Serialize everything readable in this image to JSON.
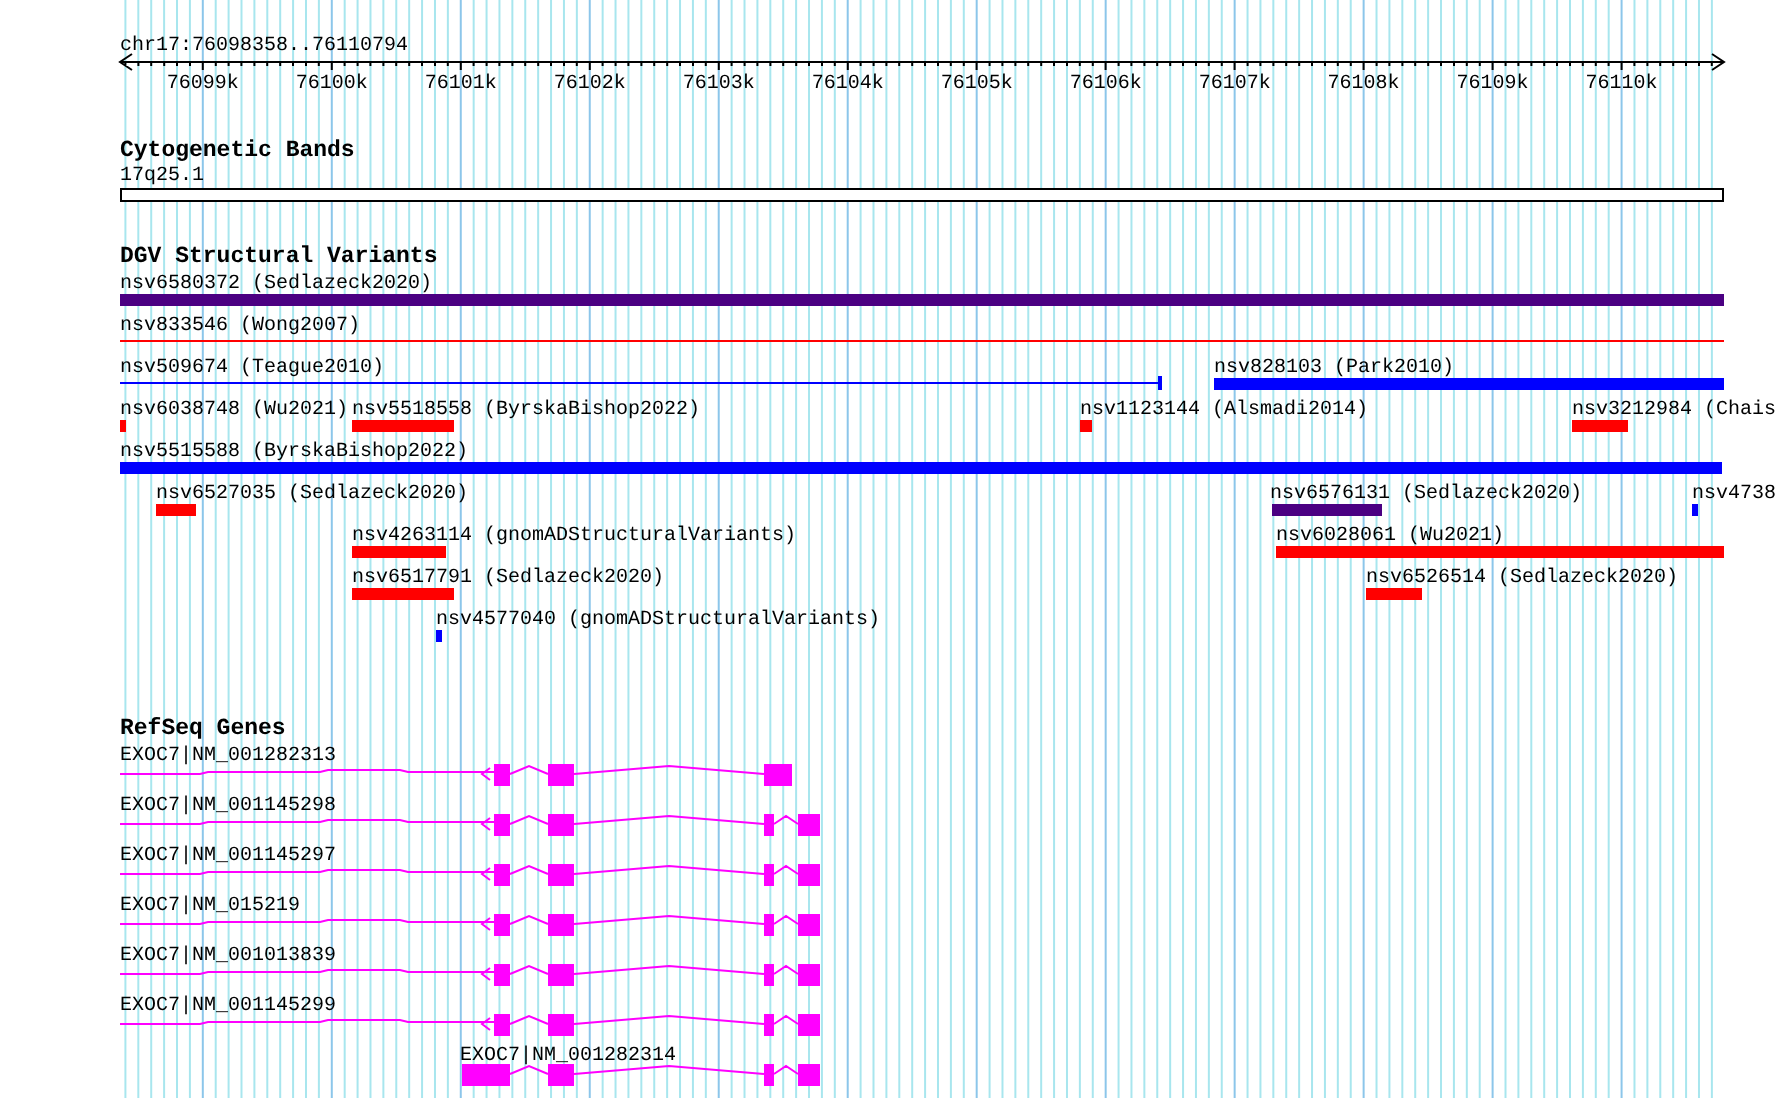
{
  "ruler": {
    "location": "chr17:76098358..76110794",
    "ticks": [
      "76099k",
      "76100k",
      "76101k",
      "76102k",
      "76103k",
      "76104k",
      "76105k",
      "76106k",
      "76107k",
      "76108k",
      "76109k",
      "76110k"
    ]
  },
  "tracks": [
    {
      "title": "Cytogenetic Bands",
      "kind": "bands",
      "features": [
        {
          "label": "17q25.1"
        }
      ]
    },
    {
      "title": "DGV Structural Variants",
      "kind": "variants",
      "features": [
        {
          "label": "nsv6580372 (Sedlazeck2020)",
          "kind": "bar",
          "color": "#4b0082"
        },
        {
          "label": "nsv833546 (Wong2007)",
          "kind": "line",
          "color": "#ff0000"
        },
        {
          "label": "nsv509674 (Teague2010)",
          "kind": "line",
          "color": "#0000ff"
        },
        {
          "label": "nsv828103 (Park2010)",
          "kind": "bar",
          "color": "#0000ff"
        },
        {
          "label": "nsv6038748 (Wu2021)",
          "kind": "bar",
          "color": "#ff0000"
        },
        {
          "label": "nsv5518558 (ByrskaBishop2022)",
          "kind": "bar",
          "color": "#ff0000"
        },
        {
          "label": "nsv1123144 (Alsmadi2014)",
          "kind": "bar",
          "color": "#ff0000"
        },
        {
          "label": "nsv3212984 (Chais",
          "kind": "bar",
          "color": "#ff0000"
        },
        {
          "label": "nsv5515588 (ByrskaBishop2022)",
          "kind": "bar",
          "color": "#0000ff"
        },
        {
          "label": "nsv6527035 (Sedlazeck2020)",
          "kind": "bar",
          "color": "#ff0000"
        },
        {
          "label": "nsv6576131 (Sedlazeck2020)",
          "kind": "bar",
          "color": "#4b0082"
        },
        {
          "label": "nsv4738",
          "kind": "bar",
          "color": "#0000ff"
        },
        {
          "label": "nsv4263114 (gnomADStructuralVariants)",
          "kind": "bar",
          "color": "#ff0000"
        },
        {
          "label": "nsv6028061 (Wu2021)",
          "kind": "bar",
          "color": "#ff0000"
        },
        {
          "label": "nsv6517791 (Sedlazeck2020)",
          "kind": "bar",
          "color": "#ff0000"
        },
        {
          "label": "nsv6526514 (Sedlazeck2020)",
          "kind": "bar",
          "color": "#ff0000"
        },
        {
          "label": "nsv4577040 (gnomADStructuralVariants)",
          "kind": "bar",
          "color": "#0000ff"
        }
      ]
    },
    {
      "title": "RefSeq Genes",
      "kind": "genes",
      "features": [
        {
          "label": "EXOC7|NM_001282313"
        },
        {
          "label": "EXOC7|NM_001145298"
        },
        {
          "label": "EXOC7|NM_001145297"
        },
        {
          "label": "EXOC7|NM_015219"
        },
        {
          "label": "EXOC7|NM_001013839"
        },
        {
          "label": "EXOC7|NM_001145299"
        },
        {
          "label": "EXOC7|NM_001282314"
        }
      ]
    }
  ]
}
